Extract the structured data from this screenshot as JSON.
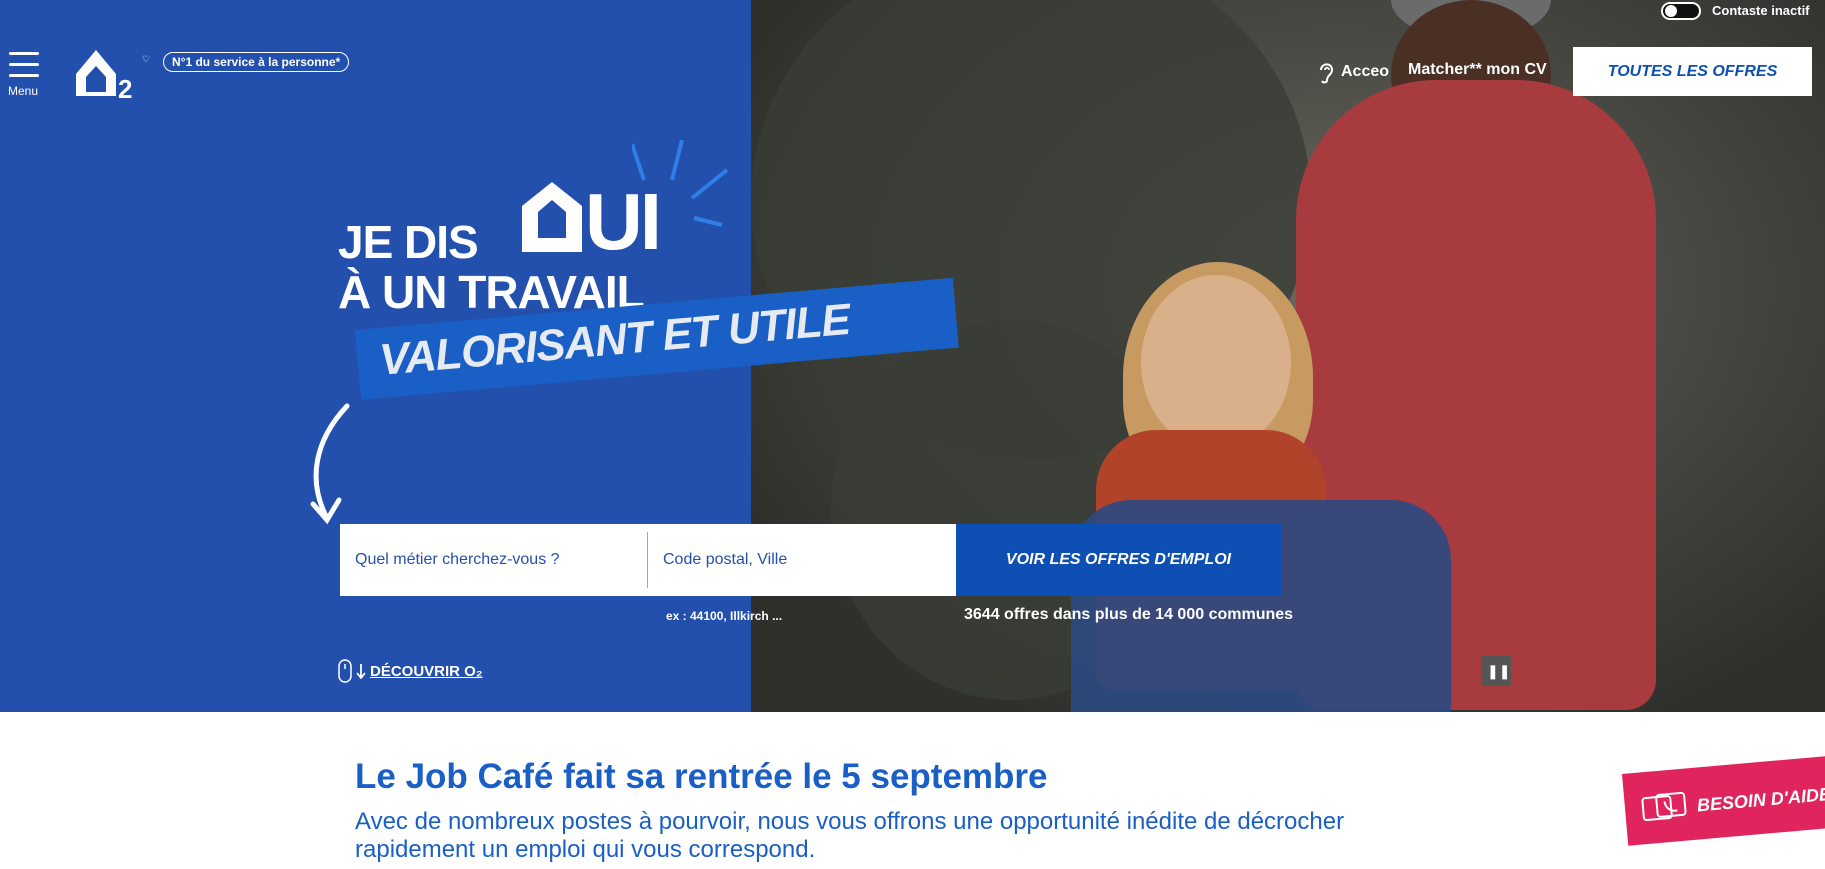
{
  "header": {
    "menu_label": "Menu",
    "logo_alt": "O2",
    "tagline": "N°1 du service à la personne*",
    "contrast_label": "Contaste inactif",
    "acceo_label": "Acceo",
    "matcher_label": "Matcher** mon CV",
    "all_offers_label": "TOUTES LES OFFRES"
  },
  "hero": {
    "line1": "JE DIS",
    "oui": "UI",
    "line2": "À UN TRAVAIL",
    "banner": "VALORISANT ET UTILE",
    "search": {
      "job_placeholder": "Quel métier cherchez-vous ?",
      "location_placeholder": "Code postal, Ville",
      "button_label": "VOIR LES OFFRES D'EMPLOI",
      "hint": "ex : 44100, Illkirch ...",
      "offers_count": "3644 offres dans plus de 14 000 communes"
    },
    "discover_label": "DÉCOUVRIR O₂",
    "pause_label": "❚❚"
  },
  "section": {
    "title": "Le Job Café fait sa rentrée le 5 septembre",
    "text": "Avec de nombreux postes à pourvoir, nous vous offrons une opportunité inédite de décrocher rapidement un emploi qui vous correspond."
  },
  "help_tab": {
    "label": "BESOIN D'AIDE"
  },
  "colors": {
    "brand_blue": "#2350ac",
    "button_blue": "#0d4fb3",
    "text_blue": "#1a5fc6",
    "help_pink": "#e0245e"
  },
  "icons": {
    "menu": "hamburger-icon",
    "acceo": "ear-icon",
    "discover": "mouse-icon",
    "help": "chat-phone-icon"
  }
}
